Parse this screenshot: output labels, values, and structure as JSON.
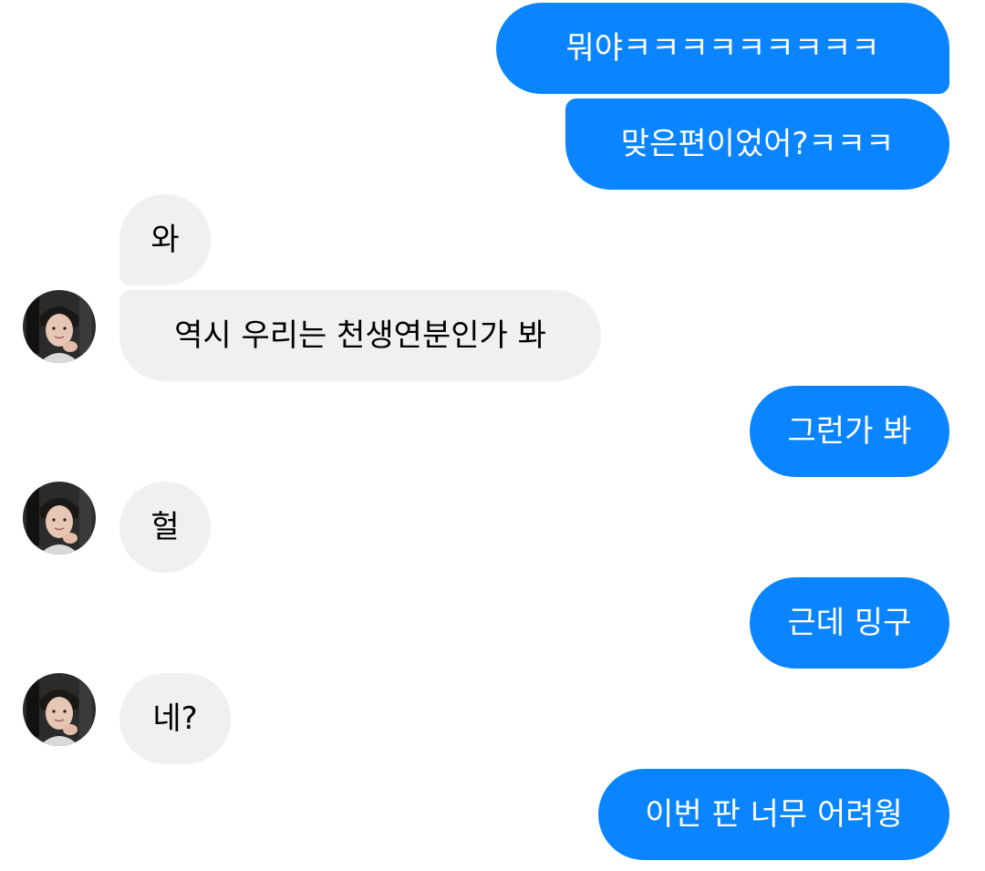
{
  "conversation": {
    "messages": [
      {
        "side": "sent",
        "text": "뭐야ㅋㅋㅋㅋㅋㅋㅋㅋㅋ"
      },
      {
        "side": "sent",
        "text": "맞은편이었어?ㅋㅋㅋ"
      },
      {
        "side": "received",
        "text": "와"
      },
      {
        "side": "received",
        "text": "역시 우리는 천생연분인가 봐"
      },
      {
        "side": "sent",
        "text": "그런가 봐"
      },
      {
        "side": "received",
        "text": "헐"
      },
      {
        "side": "sent",
        "text": "근데 밍구"
      },
      {
        "side": "received",
        "text": "네?"
      },
      {
        "side": "sent",
        "text": "이번 판 너무 어려웡"
      }
    ]
  },
  "colors": {
    "sent_bubble": "#0a84ff",
    "received_bubble": "#f0f0f0",
    "background": "#ffffff"
  },
  "icons": {
    "contact_avatar": "person-photo-avatar"
  }
}
